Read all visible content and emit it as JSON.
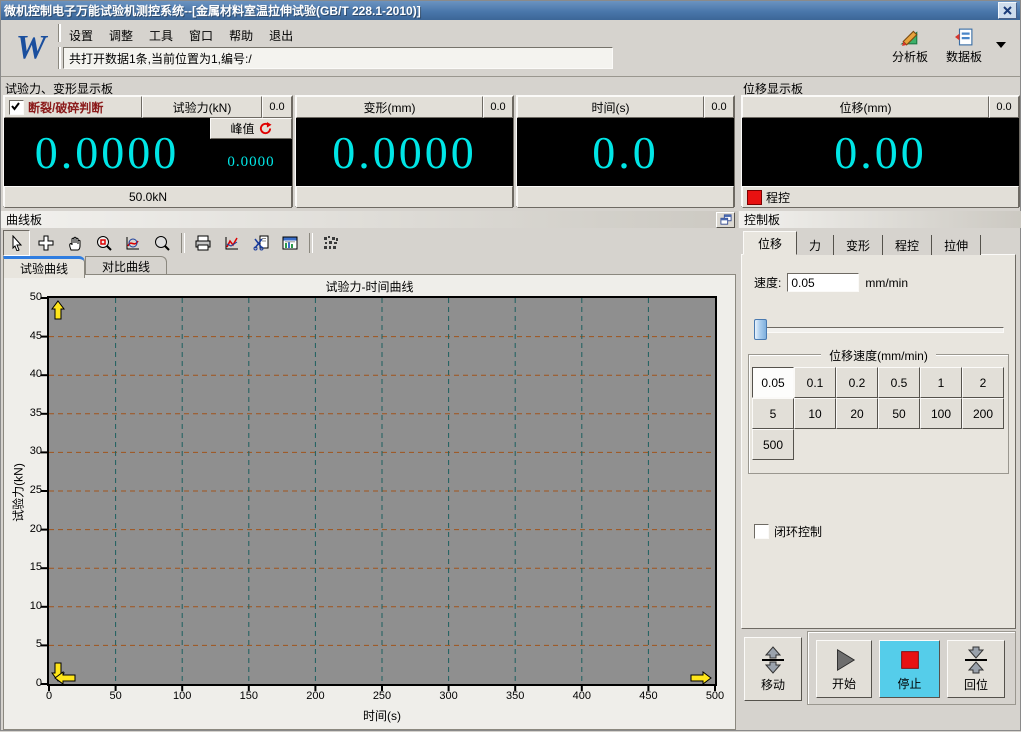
{
  "window": {
    "title": "微机控制电子万能试验机测控系统--[金属材料室温拉伸试验(GB/T 228.1-2010)]"
  },
  "menu": {
    "items": [
      "设置",
      "调整",
      "工具",
      "窗口",
      "帮助",
      "退出"
    ]
  },
  "statusbar": {
    "text": "共打开数据1条,当前位置为1,编号:/"
  },
  "topbar": {
    "analysis_label": "分析板",
    "data_label": "数据板"
  },
  "icons": {
    "topbar": [
      "analysis-board-icon",
      "data-board-icon",
      "dropdown-arrow-icon"
    ],
    "curve_toolbar": [
      "cursor",
      "crosshair",
      "pan-hand",
      "zoom-box",
      "curve-inspect",
      "magnifier",
      "print",
      "curve-chart",
      "snip",
      "report-window",
      "code-stamp"
    ]
  },
  "colors": {
    "display_value": "#00e6e6",
    "display_bg": "#000000",
    "alert_red": "#e81111",
    "stop_button_bg": "#55cdea",
    "break_label_red": "#8b1a1a",
    "active_tab_accent": "#2f7de0"
  },
  "sections": {
    "force_title": "试验力、变形显示板",
    "disp_title": "位移显示板",
    "curve_title": "曲线板",
    "control_title": "控制板"
  },
  "force_panel": {
    "break_label": "断裂/破碎判断",
    "break_checked": true,
    "name": "试验力(kN)",
    "mini": "0.0",
    "value": "0.0000",
    "peak_label": "峰值",
    "peak_value": "0.0000",
    "range": "50.0kN"
  },
  "deform_panel": {
    "name": "变形(mm)",
    "mini": "0.0",
    "value": "0.0000"
  },
  "time_panel": {
    "name": "时间(s)",
    "mini": "0.0",
    "value": "0.0"
  },
  "disp_panel": {
    "name": "位移(mm)",
    "mini": "0.0",
    "value": "0.00",
    "mode": "程控"
  },
  "curve": {
    "tabs": [
      "试验曲线",
      "对比曲线"
    ],
    "active_tab": "试验曲线"
  },
  "chart_data": {
    "type": "line",
    "title": "试验力-时间曲线",
    "xlabel": "时间(s)",
    "ylabel": "试验力(kN)",
    "xlim": [
      0,
      500
    ],
    "ylim": [
      0,
      50
    ],
    "xtick_step": 50,
    "ytick_step": 5,
    "grid": true,
    "grid_color_h": "#a1541c",
    "grid_color_v": "#1d5f5f",
    "plot_bg": "#8f8f8f",
    "legend": "none",
    "series": [
      {
        "name": "试验力",
        "x": [],
        "y": []
      }
    ]
  },
  "control": {
    "tabs": [
      "位移",
      "力",
      "变形",
      "程控",
      "拉伸"
    ],
    "active_tab": "位移",
    "speed_label": "速度:",
    "speed_value": "0.05",
    "speed_unit": "mm/min",
    "group_title": "位移速度(mm/min)",
    "speeds": [
      "0.05",
      "0.1",
      "0.2",
      "0.5",
      "1",
      "2",
      "5",
      "10",
      "20",
      "50",
      "100",
      "200",
      "500"
    ],
    "active_speed": "0.05",
    "closed_loop_label": "闭环控制",
    "closed_loop_checked": false,
    "buttons": {
      "move": "移动",
      "start": "开始",
      "stop": "停止",
      "return": "回位"
    }
  }
}
